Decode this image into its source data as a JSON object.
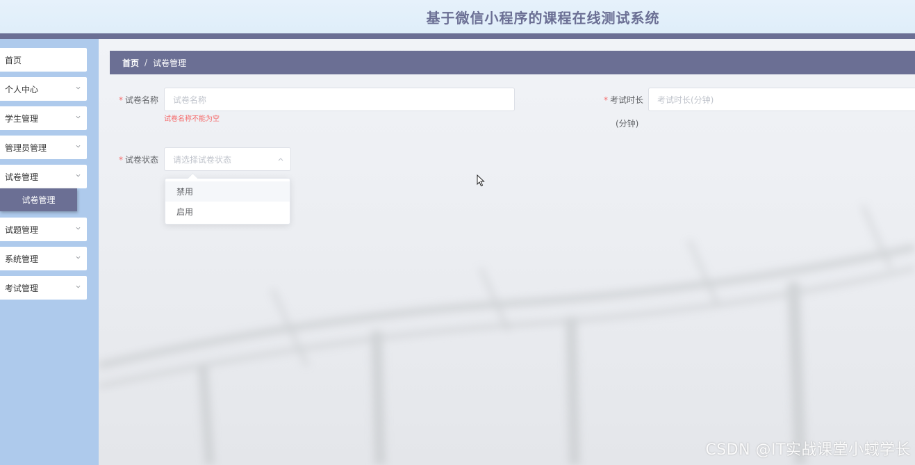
{
  "header": {
    "title": "基于微信小程序的课程在线测试系统"
  },
  "sidebar": {
    "items": [
      {
        "label": "首页",
        "icon": "none"
      },
      {
        "label": "个人中心",
        "icon": "chevron-down-icon"
      },
      {
        "label": "学生管理",
        "icon": "chevron-down-icon"
      },
      {
        "label": "管理员管理",
        "icon": "chevron-down-icon"
      },
      {
        "label": "试卷管理",
        "icon": "chevron-down-icon"
      },
      {
        "label": "试题管理",
        "icon": "chevron-down-icon"
      },
      {
        "label": "系统管理",
        "icon": "chevron-down-icon"
      },
      {
        "label": "考试管理",
        "icon": "chevron-down-icon"
      }
    ],
    "active_submenu": "试卷管理"
  },
  "breadcrumb": {
    "home": "首页",
    "separator": "/",
    "current": "试卷管理"
  },
  "form": {
    "required_mark": "*",
    "paper_name": {
      "label": "试卷名称",
      "placeholder": "试卷名称",
      "value": "",
      "error": "试卷名称不能为空"
    },
    "duration": {
      "label": "考试时长",
      "label_unit": "(分钟)",
      "placeholder": "考试时长(分钟)",
      "value": ""
    },
    "status": {
      "label": "试卷状态",
      "placeholder": "请选择试卷状态",
      "value": "",
      "open": true,
      "options": [
        "禁用",
        "启用"
      ],
      "hovered_option": "禁用"
    }
  },
  "watermark": "CSDN @IT实战课堂小蜮学长",
  "colors": {
    "primary": "#6b6f94",
    "sidebar_bg": "#aecaec",
    "header_bg": "#e6f1fb",
    "error": "#f56c6c",
    "placeholder": "#c0c4cc"
  }
}
